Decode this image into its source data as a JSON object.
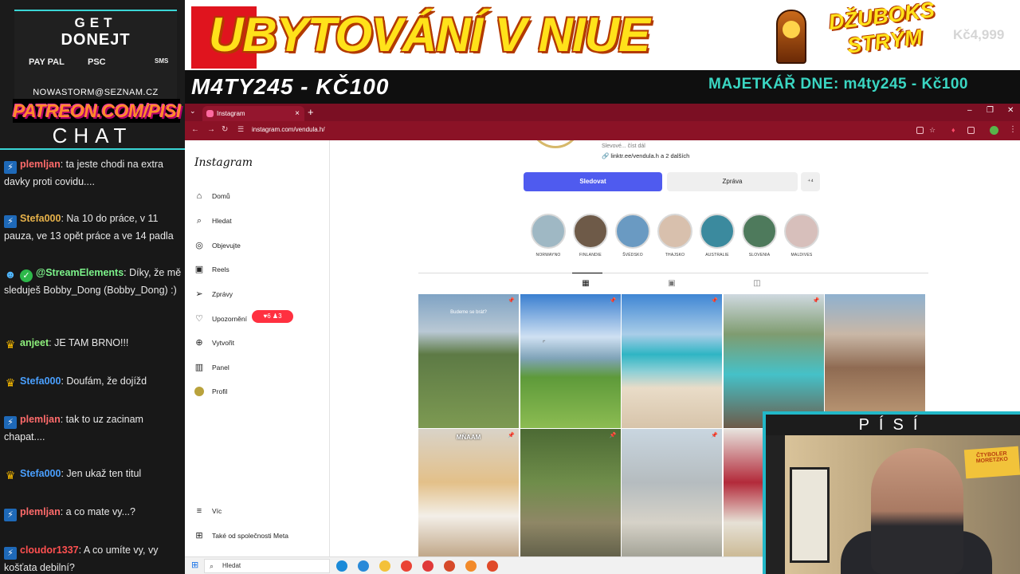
{
  "donate": {
    "title_line1": "GET",
    "title_line2": "DONEJT",
    "payment_paypal": "PAY PAL",
    "payment_psc": "PSC",
    "payment_sms": "SMS",
    "email": "NOWASTORM@SEZNAM.CZ"
  },
  "patreon": "PATREON.COM/PISI",
  "chat": {
    "title": "CHAT",
    "messages": [
      {
        "user": "plemljan",
        "color": "#ff6b6b",
        "badge": "blue",
        "text": ": ta jeste chodi na extra davky proti covidu...."
      },
      {
        "user": "Stefa000",
        "color": "#e7b24a",
        "badge": "blue",
        "text": ": Na 10 do práce, v 11 pauza, ve 13 opět práce a ve 14 padla"
      },
      {
        "user": "@StreamElements",
        "color": "#7cf28a",
        "badge": "bot",
        "text": ": Díky, že mě sleduješ Bobby_Dong (Bobby_Dong) :)"
      },
      {
        "user": "anjeet",
        "color": "#8ef07c",
        "badge": "crown",
        "text": ": JE TAM BRNO!!!"
      },
      {
        "user": "Stefa000",
        "color": "#4aa0ff",
        "badge": "crown",
        "text": ": Doufám, že dojížd"
      },
      {
        "user": "plemljan",
        "color": "#ff6b6b",
        "badge": "blue",
        "text": ": tak to uz zacinam chapat...."
      },
      {
        "user": "Stefa000",
        "color": "#4aa0ff",
        "badge": "crown",
        "text": ": Jen ukaž ten titul"
      },
      {
        "user": "plemljan",
        "color": "#ff6b6b",
        "badge": "blue",
        "text": ": a co mate vy...?"
      },
      {
        "user": "cloudor1337",
        "color": "#ff5050",
        "badge": "blue",
        "text": ": A co umíte vy, vy košťata debilní?"
      }
    ]
  },
  "banner": {
    "title": "UBYTOVÁNÍ V NIUE",
    "ghost_text": "K...6",
    "jukebox_text": "DŽUBOKS STRÝM",
    "price": "Kč4,999"
  },
  "ticker": {
    "left": "M4TY245 - KČ100",
    "right": "MAJETKÁŘ DNE: m4ty245 - Kč100"
  },
  "browser": {
    "tab_title": "Instagram",
    "tab_close": "×",
    "tab_add": "+",
    "url": "instagram.com/vendula.h/",
    "win_minimize": "–",
    "win_maximize": "❐",
    "win_close": "✕"
  },
  "instagram": {
    "logo": "Instagram",
    "nav": [
      {
        "label": "Domů",
        "icon": "⌂"
      },
      {
        "label": "Hledat",
        "icon": "⌕"
      },
      {
        "label": "Objevujte",
        "icon": "◎"
      },
      {
        "label": "Reels",
        "icon": "▣"
      },
      {
        "label": "Zprávy",
        "icon": "➢"
      },
      {
        "label": "Upozornění",
        "icon": "♡"
      },
      {
        "label": "Vytvořit",
        "icon": "⊕"
      },
      {
        "label": "Panel",
        "icon": "▥"
      },
      {
        "label": "Profil",
        "icon": ""
      }
    ],
    "notif_badge": "♥6  ♟3",
    "more": "Víc",
    "meta": "Také od společnosti Meta",
    "bio_line1": "Slevové... číst dál",
    "bio_link": "🔗 linktr.ee/vendula.h a 2 dalších",
    "follow_button": "Sledovat",
    "message_button": "Zpráva",
    "add_user_button": "⁺⁴",
    "highlights": [
      {
        "label": "NORWAYNO",
        "color": "#9fb8c4"
      },
      {
        "label": "FINLANDIE",
        "color": "#6e5a48"
      },
      {
        "label": "ŠVÉDSKO",
        "color": "#6a9ac2"
      },
      {
        "label": "THAJSKO",
        "color": "#d8c0ad"
      },
      {
        "label": "AUSTRALIE",
        "color": "#3b8a9e"
      },
      {
        "label": "SLOVENIA",
        "color": "#4e7a5c"
      },
      {
        "label": "MALDIVES",
        "color": "#d7bfbb"
      }
    ],
    "posts": [
      {
        "bg": "linear-gradient(#7fa3c4 0%,#b9c8d4 28%,#5d7a45 45%,#7d9a52 100%)",
        "caption": "Budeme se brát?"
      },
      {
        "bg": "linear-gradient(#3a7fd0 0%,#cfe0f2 32%,#7fa3b8 48%,#5e9a3a 62%,#8cbc52 100%)",
        "caption": ""
      },
      {
        "bg": "linear-gradient(#3f86d4 0%,#a9cde8 30%,#2fb5c4 45%,#8fd0d6 58%,#e9dcc8 70%,#d7c4aa 100%)",
        "caption": ""
      },
      {
        "bg": "linear-gradient(#cfd9e0 0%,#7f9c70 30%,#45c1c8 60%,#6d5a48 100%)",
        "caption": ""
      },
      {
        "bg": "linear-gradient(#8fb1cf 0%,#c9b7a6 30%,#8f6b52 55%,#c4a17c 100%)",
        "caption": ""
      },
      {
        "bg": "linear-gradient(#d9d3c8 0%,#e3c089 40%,#f3efe8 65%,#b99c7a 100%)",
        "caption": "MŇAAM"
      },
      {
        "bg": "linear-gradient(#4c6a34 0%,#6f8d4a 40%,#8f8766 70%,#5b5a45 100%)",
        "caption": ""
      },
      {
        "bg": "linear-gradient(#c9d6e0 0%,#b5bcbf 40%,#d6d2c8 70%,#9b9b8e 100%)",
        "caption": ""
      },
      {
        "bg": "linear-gradient(#e7e3dd 0%,#b32a3a 40%,#e6e1d6 70%,#c7b38a 100%)",
        "caption": ""
      }
    ]
  },
  "taskbar": {
    "search": "Hledat",
    "apps": [
      "#1a8ad8",
      "#2a8ad8",
      "#f3c13a",
      "#ea4335",
      "#e03a3a",
      "#d64a2a",
      "#f28a2a",
      "#e04a2a"
    ]
  },
  "cam": {
    "title": "PÍSÍ",
    "sign_text": "ČTYBOLER MORETZKO"
  }
}
